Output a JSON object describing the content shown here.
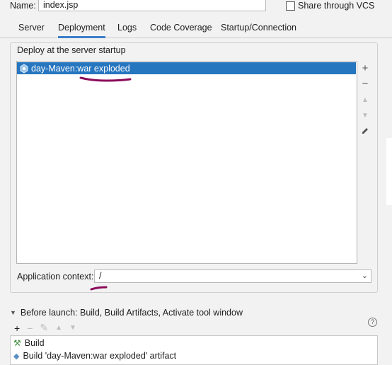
{
  "run_config": {
    "name_label": "Name:",
    "name_value": "index.jsp",
    "share_label": "Share through VCS"
  },
  "tabs": [
    {
      "label": "Server"
    },
    {
      "label": "Deployment"
    },
    {
      "label": "Logs"
    },
    {
      "label": "Code Coverage"
    },
    {
      "label": "Startup/Connection"
    }
  ],
  "deploy": {
    "title": "Deploy at the server startup",
    "items": [
      {
        "label": "day-Maven:war exploded"
      }
    ]
  },
  "context": {
    "label": "Application context:",
    "value": "/"
  },
  "before_launch": {
    "header": "Before launch: Build, Build Artifacts, Activate tool window",
    "items": [
      {
        "label": "Build"
      },
      {
        "label": "Build 'day-Maven:war exploded' artifact"
      }
    ]
  },
  "colors": {
    "selection": "#2675bf",
    "tab_underline": "#3d7ec9",
    "annotation": "#8b0a5a"
  }
}
